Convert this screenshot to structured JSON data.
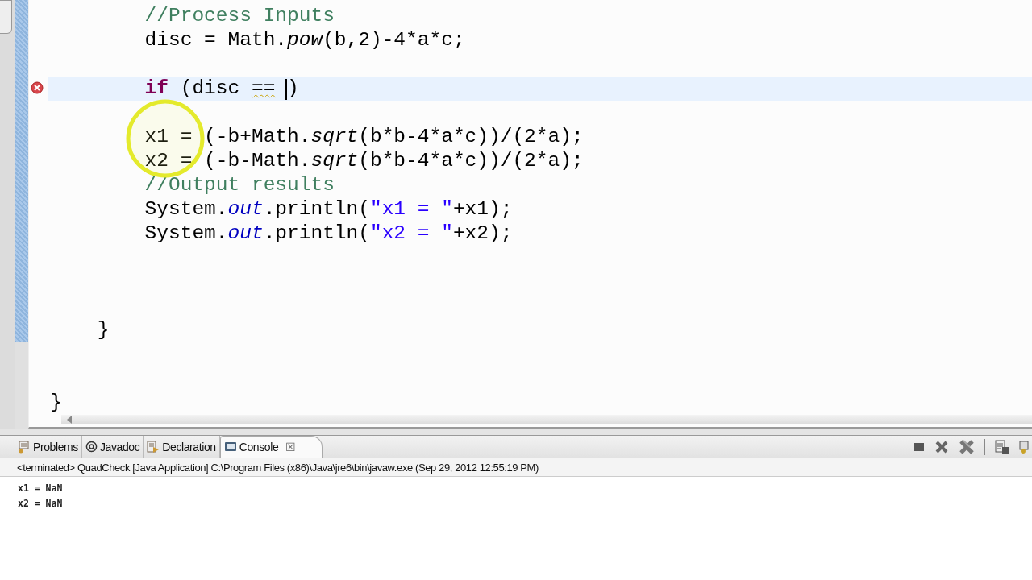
{
  "editor": {
    "lines": [
      {
        "children": [
          {
            "children": [
              {
                "current": false,
                "error": false,
                "tokens": [
                  {
                    "kind": "comment",
                    "text": "//Process Inputs"
                  }
                ]
              },
              {
                "current": false,
                "error": false,
                "tokens": [
                  {
                    "kind": "plain",
                    "text": "disc = Math."
                  },
                  {
                    "kind": "static_method",
                    "text": "pow"
                  },
                  {
                    "kind": "plain",
                    "text": "(b,2)-4*a*c;"
                  }
                ]
              },
              {
                "current": false,
                "error": false
              },
              {
                "current": true,
                "error": true,
                "tokens": [
                  {
                    "kind": "keyword",
                    "text": "if"
                  },
                  {
                    "kind": "plain",
                    "text": " (disc "
                  },
                  {
                    "kind": "error",
                    "text": "=="
                  },
                  {
                    "kind": "plain",
                    "text": " )",
                    "caret": true
                  }
                ]
              },
              {
                "current": false,
                "error": false
              },
              {
                "current": false,
                "error": false,
                "tokens": [
                  {
                    "kind": "plain",
                    "text": "x1 = (-b+Math."
                  },
                  {
                    "kind": "static_method",
                    "text": "sqrt"
                  },
                  {
                    "kind": "plain",
                    "text": "(b*b-4*a*c))/(2*a);"
                  }
                ]
              },
              {
                "current": false,
                "error": false,
                "tokens": [
                  {
                    "kind": "plain",
                    "text": "x2 = (-b-Math."
                  },
                  {
                    "kind": "static_method",
                    "text": "sqrt"
                  },
                  {
                    "kind": "plain",
                    "text": "(b*b-4*a*c))/(2*a);"
                  }
                ]
              },
              {
                "current": false,
                "error": false,
                "tokens": [
                  {
                    "kind": "comment",
                    "text": "//Output results"
                  }
                ]
              },
              {
                "current": false,
                "error": false,
                "tokens": [
                  {
                    "kind": "plain",
                    "text": "System."
                  },
                  {
                    "kind": "static_field",
                    "text": "out"
                  },
                  {
                    "kind": "plain",
                    "text": ".println("
                  },
                  {
                    "kind": "string",
                    "text": "\"x1 = \""
                  },
                  {
                    "kind": "plain",
                    "text": "+x1);"
                  }
                ]
              },
              {
                "current": false,
                "error": false,
                "tokens": [
                  {
                    "kind": "plain",
                    "text": "System."
                  },
                  {
                    "kind": "static_field",
                    "text": "out"
                  },
                  {
                    "kind": "plain",
                    "text": ".println("
                  },
                  {
                    "kind": "string",
                    "text": "\"x2 = \""
                  },
                  {
                    "kind": "plain",
                    "text": "+x2);"
                  }
                ]
              },
              {
                "current": false,
                "error": false
              },
              {
                "current": false,
                "error": false
              },
              {
                "current": false,
                "error": false
              }
            ]
          },
          {
            "current": false,
            "error": false,
            "tokens": [
              {
                "kind": "plain",
                "text": "}"
              }
            ]
          },
          {
            "current": false,
            "error": false
          },
          {
            "current": false,
            "error": false
          }
        ]
      },
      {
        "current": false,
        "error": false,
        "tokens": [
          {
            "kind": "plain",
            "text": "}"
          }
        ]
      }
    ]
  },
  "console": {
    "tabs": [
      {
        "kind": "problems",
        "label": "Problems",
        "selected": false
      },
      {
        "kind": "javadoc",
        "label": "Javadoc",
        "selected": false
      },
      {
        "kind": "declaration",
        "label": "Declaration",
        "selected": false
      },
      {
        "kind": "console",
        "label": "Console",
        "selected": true,
        "close": "☒"
      }
    ],
    "status": "<terminated> QuadCheck [Java Application] C:\\Program Files (x86)\\Java\\jre6\\bin\\javaw.exe (Sep 29, 2012 12:55:19 PM)",
    "output": [
      "x1 = NaN",
      "x2 = NaN"
    ]
  }
}
